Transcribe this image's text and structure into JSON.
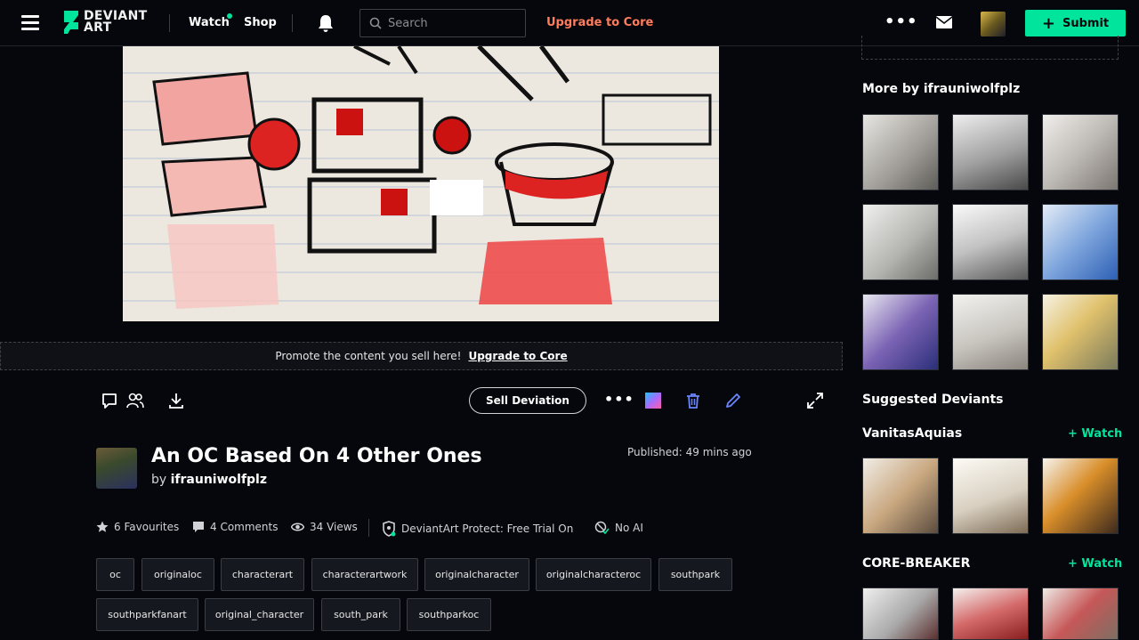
{
  "header": {
    "logo_line1": "DEVIANT",
    "logo_line2": "ART",
    "nav_watch": "Watch",
    "nav_shop": "Shop",
    "search_placeholder": "Search",
    "upgrade": "Upgrade to Core",
    "more": "•••",
    "submit": "Submit"
  },
  "colors": {
    "accent": "#00e59b",
    "upgrade": "#ff7d5c",
    "background": "#06070d"
  },
  "promo": {
    "text": "Promote the content you sell here!",
    "link": "Upgrade to Core"
  },
  "actions": {
    "sell": "Sell Deviation",
    "more": "•••"
  },
  "deviation": {
    "title": "An OC Based On 4 Other Ones",
    "by": "by",
    "author": "ifrauniwolfplz",
    "published": "Published: 49 mins ago",
    "favourites": "6 Favourites",
    "comments": "4 Comments",
    "views": "34 Views",
    "protect": "DeviantArt Protect: Free Trial On",
    "ai": "No AI",
    "tags": [
      "oc",
      "originaloc",
      "characterart",
      "characterartwork",
      "originalcharacter",
      "originalcharacteroc",
      "southpark",
      "southparkfanart",
      "original_character",
      "south_park",
      "southparkoc"
    ]
  },
  "sidebar": {
    "more_by": "More by ifrauniwolfplz",
    "suggested": "Suggested Deviants",
    "deviant1": "VanitasAquias",
    "deviant2": "CORE-BREAKER",
    "watch": "Watch"
  }
}
